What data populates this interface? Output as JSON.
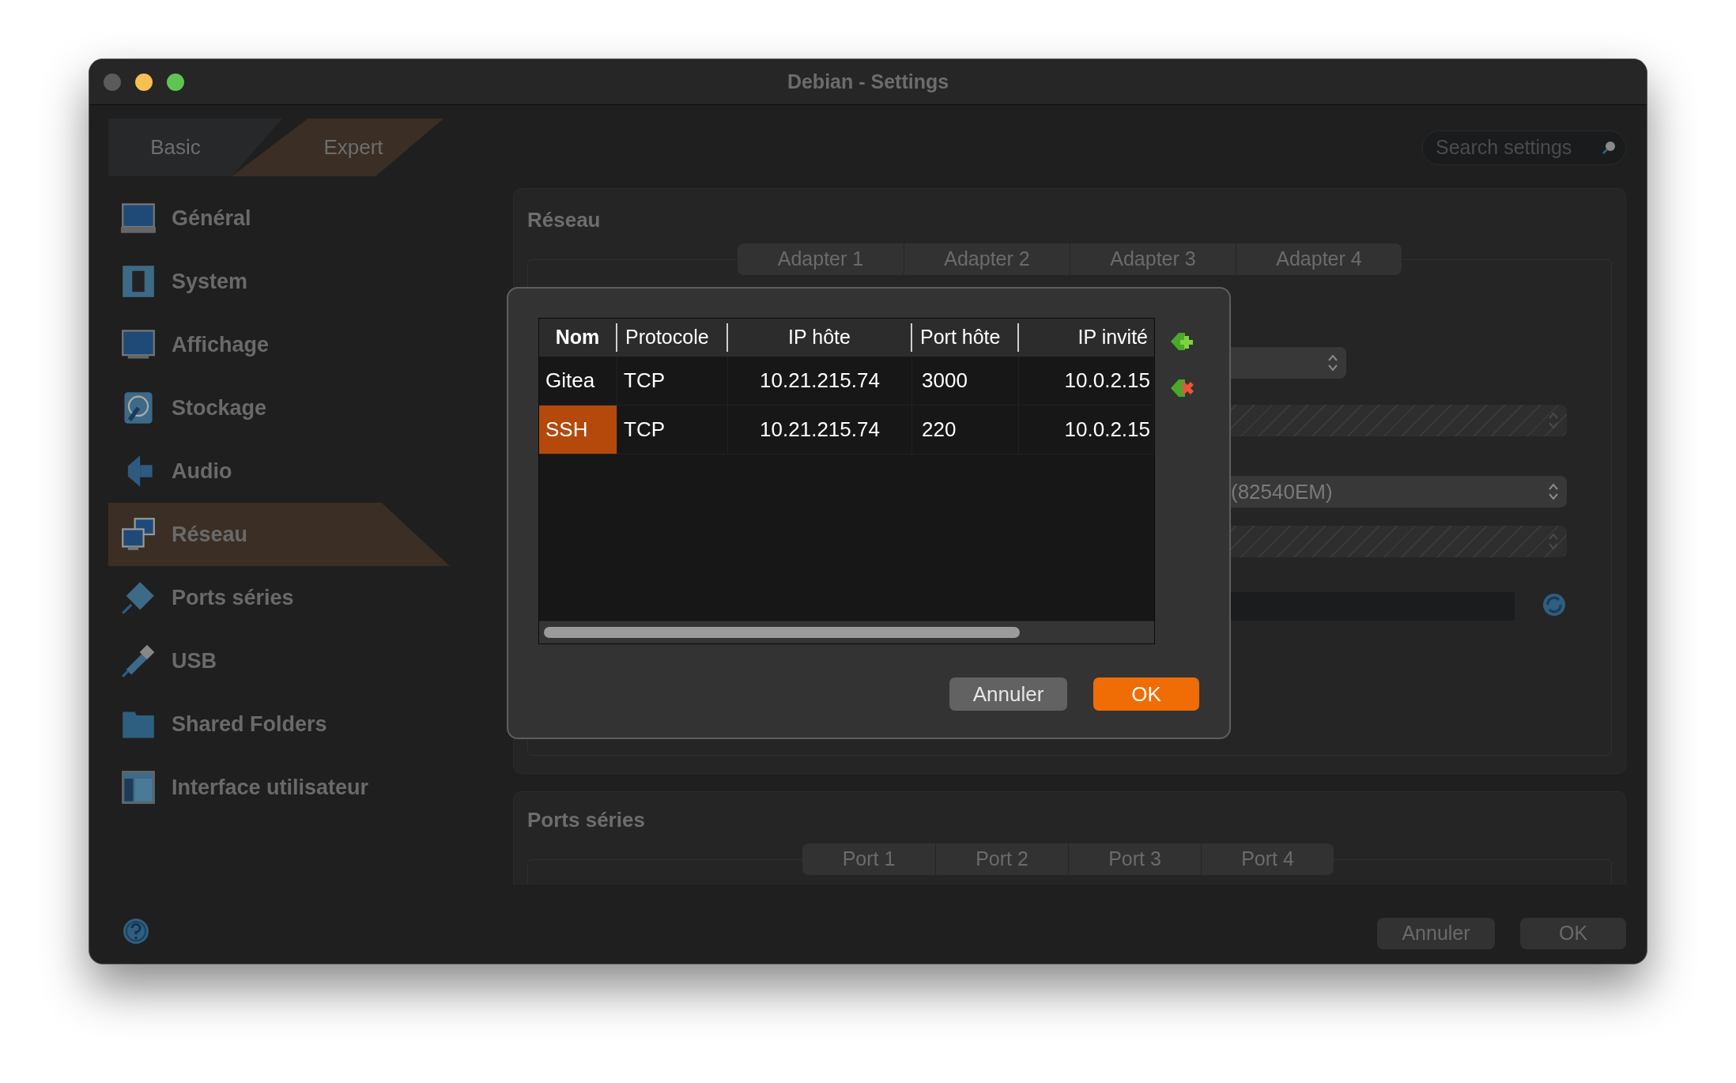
{
  "window": {
    "title": "Debian - Settings"
  },
  "modes": [
    {
      "label": "Basic",
      "selected": false
    },
    {
      "label": "Expert",
      "selected": true
    }
  ],
  "search": {
    "placeholder": "Search settings"
  },
  "sidebar": {
    "items": [
      {
        "label": "Général",
        "selected": false
      },
      {
        "label": "System",
        "selected": false
      },
      {
        "label": "Affichage",
        "selected": false
      },
      {
        "label": "Stockage",
        "selected": false
      },
      {
        "label": "Audio",
        "selected": false
      },
      {
        "label": "Réseau",
        "selected": true
      },
      {
        "label": "Ports séries",
        "selected": false
      },
      {
        "label": "USB",
        "selected": false
      },
      {
        "label": "Shared Folders",
        "selected": false
      },
      {
        "label": "Interface utilisateur",
        "selected": false
      }
    ]
  },
  "network": {
    "title": "Réseau",
    "tabs": [
      "Adapter 1",
      "Adapter 2",
      "Adapter 3",
      "Adapter 4"
    ],
    "fields": [
      {
        "kind": "short-select"
      },
      {
        "kind": "disabled-select"
      },
      {
        "kind": "select",
        "value": "(82540EM)"
      },
      {
        "kind": "disabled-select"
      },
      {
        "kind": "text-refresh"
      }
    ]
  },
  "serial_ports": {
    "title": "Ports séries",
    "tabs": [
      "Port 1",
      "Port 2",
      "Port 3",
      "Port 4"
    ]
  },
  "buttons": [
    "Annuler",
    "OK"
  ],
  "dialog": {
    "columns": [
      {
        "label": "Nom",
        "sorted": true
      },
      {
        "label": "Protocole",
        "sorted": false
      },
      {
        "label": "IP hôte",
        "sorted": false
      },
      {
        "label": "Port hôte",
        "sorted": false
      },
      {
        "label": "IP invité",
        "sorted": false
      }
    ],
    "rows": [
      {
        "selected": false,
        "cells": [
          "Gitea",
          "TCP",
          "10.21.215.74",
          "3000",
          "10.0.2.15"
        ]
      },
      {
        "selected": true,
        "cells": [
          "SSH",
          "TCP",
          "10.21.215.74",
          "220",
          "10.0.2.15"
        ]
      }
    ],
    "buttons": [
      "Annuler",
      "OK"
    ]
  }
}
